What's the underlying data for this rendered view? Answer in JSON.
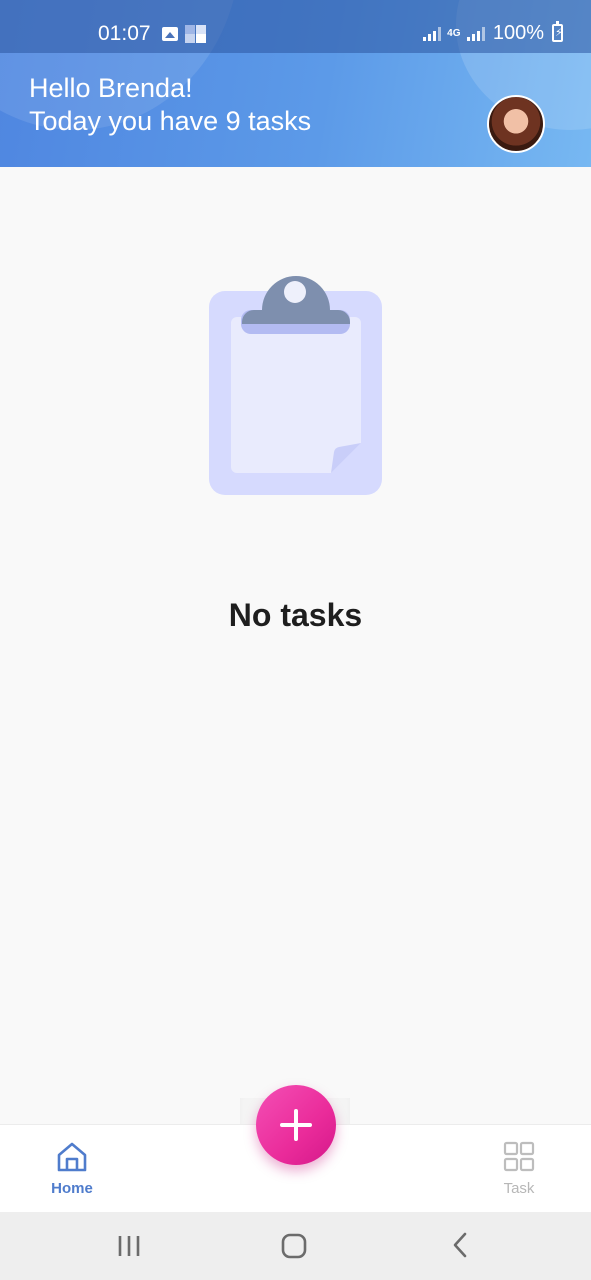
{
  "status_bar": {
    "time": "01:07",
    "network": "4G",
    "battery": "100%"
  },
  "header": {
    "greeting": "Hello Brenda!",
    "subtitle": "Today you have 9 tasks"
  },
  "empty_state": {
    "message": "No tasks"
  },
  "bottom_nav": {
    "items": [
      {
        "label": "Home",
        "icon": "home-icon",
        "active": true
      },
      {
        "label": "Task",
        "icon": "grid-icon",
        "active": false
      }
    ],
    "fab_icon": "plus-icon"
  },
  "colors": {
    "header_start": "#4f86e0",
    "header_end": "#77b8f2",
    "fab": "#ea2b9a",
    "active_nav": "#4f7ccc",
    "inactive_nav": "#b7b7b7",
    "clipboard_board": "#d6dafe",
    "clipboard_clip": "#7e8fae"
  }
}
